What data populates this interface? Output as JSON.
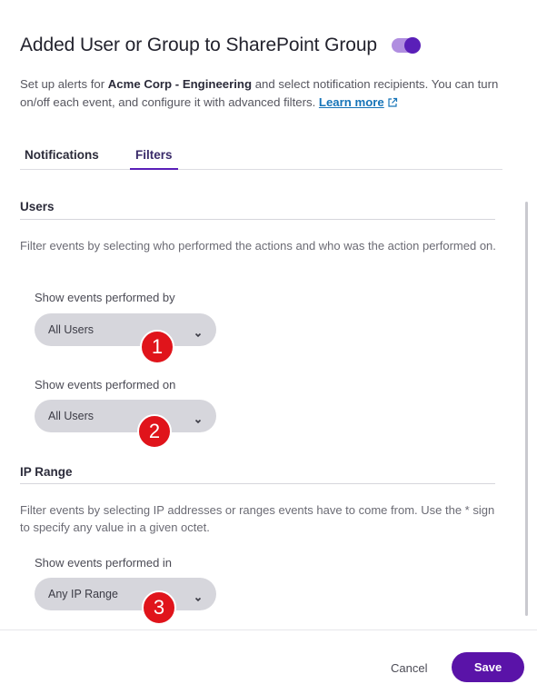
{
  "header": {
    "title": "Added User or Group to SharePoint Group",
    "toggle_on": true
  },
  "description": {
    "part1": "Set up alerts for ",
    "org": "Acme Corp - Engineering",
    "part2": " and select notification recipients. You can turn on/off each event, and configure it with advanced filters. ",
    "learn_more": "Learn more"
  },
  "tabs": [
    {
      "label": "Notifications",
      "active": false
    },
    {
      "label": "Filters",
      "active": true
    }
  ],
  "users_section": {
    "title": "Users",
    "description": "Filter events by selecting who performed the actions and who was the action performed on.",
    "performed_by": {
      "label": "Show events performed by",
      "value": "All Users",
      "marker": "1"
    },
    "performed_on": {
      "label": "Show events performed on",
      "value": "All Users",
      "marker": "2"
    }
  },
  "ip_section": {
    "title": "IP Range",
    "description": "Filter events by selecting IP addresses or ranges events have to come from. Use the * sign to specify any value in a given octet.",
    "performed_in": {
      "label": "Show events performed in",
      "value": "Any IP Range",
      "marker": "3"
    }
  },
  "footer": {
    "cancel_label": "Cancel",
    "save_label": "Save"
  },
  "colors": {
    "accent": "#5a13a8",
    "toggle_track": "#b08ee0",
    "link": "#1674b8",
    "marker": "#e0141b"
  }
}
